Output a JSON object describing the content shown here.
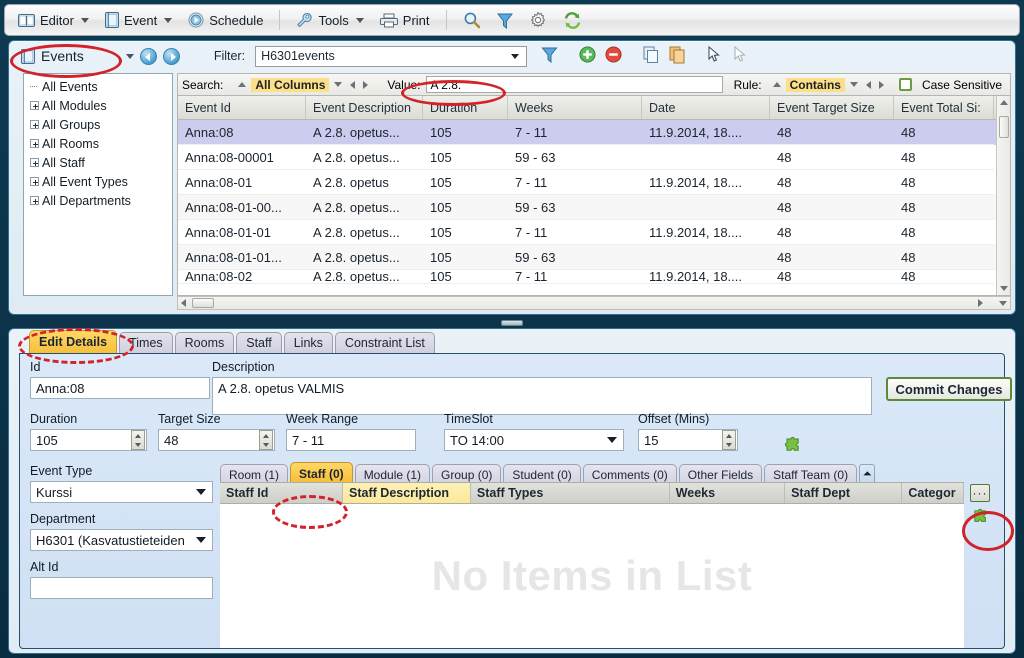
{
  "menubar": {
    "items": [
      {
        "label": "Editor",
        "icon": "book-open-icon",
        "caret": true
      },
      {
        "label": "Event",
        "icon": "book-icon",
        "caret": true
      },
      {
        "label": "Schedule",
        "icon": "play-circle-icon",
        "caret": false
      },
      {
        "label": "Tools",
        "icon": "wrench-icon",
        "caret": true
      },
      {
        "label": "Print",
        "icon": "printer-icon",
        "caret": false
      }
    ],
    "right_icons": [
      "magnifier-icon",
      "funnel-filter-icon",
      "gear-icon",
      "refresh-sync-icon"
    ]
  },
  "events_panel": {
    "title": "Events",
    "title_icon": "book-icon",
    "filter_label": "Filter:",
    "filter_value": "H6301events",
    "toolbar_icons": [
      "funnel-filter-icon",
      "add-green-icon",
      "remove-red-icon",
      "copy-icon",
      "paste-icon",
      "select-pointer-icon",
      "deselect-pointer-icon"
    ],
    "tree": [
      {
        "label": "All Events",
        "expandable": false
      },
      {
        "label": "All Modules",
        "expandable": true
      },
      {
        "label": "All Groups",
        "expandable": true
      },
      {
        "label": "All Rooms",
        "expandable": true
      },
      {
        "label": "All Staff",
        "expandable": true
      },
      {
        "label": "All Event Types",
        "expandable": true
      },
      {
        "label": "All Departments",
        "expandable": true
      }
    ],
    "search": {
      "label": "Search:",
      "scope": "All Columns",
      "value_label": "Value:",
      "value": "A 2.8.",
      "rule_label": "Rule:",
      "rule": "Contains",
      "case_sensitive_label": "Case Sensitive",
      "case_sensitive_checked": false
    },
    "grid": {
      "columns": [
        "Event Id",
        "Event Description",
        "Duration",
        "Weeks",
        "Date",
        "Event Target Size",
        "Event Total Si:"
      ],
      "rows": [
        {
          "cells": [
            "Anna:08",
            "A 2.8. opetus...",
            "105",
            "7 - 11",
            "11.9.2014, 18....",
            "48",
            "48"
          ],
          "selected": true
        },
        {
          "cells": [
            "Anna:08-00001",
            "A 2.8. opetus...",
            "105",
            "59 - 63",
            "",
            "48",
            "48"
          ],
          "selected": false
        },
        {
          "cells": [
            "Anna:08-01",
            "A 2.8. opetus",
            "105",
            "7 - 11",
            "11.9.2014, 18....",
            "48",
            "48"
          ],
          "selected": false
        },
        {
          "cells": [
            "Anna:08-01-00...",
            "A 2.8. opetus...",
            "105",
            "59 - 63",
            "",
            "48",
            "48"
          ],
          "selected": false
        },
        {
          "cells": [
            "Anna:08-01-01",
            "A 2.8. opetus...",
            "105",
            "7 - 11",
            "11.9.2014, 18....",
            "48",
            "48"
          ],
          "selected": false
        },
        {
          "cells": [
            "Anna:08-01-01...",
            "A 2.8. opetus...",
            "105",
            "59 - 63",
            "",
            "48",
            "48"
          ],
          "selected": false
        },
        {
          "cells": [
            "Anna:08-02",
            "A 2.8. opetus...",
            "105",
            "7 - 11",
            "11.9.2014, 18....",
            "48",
            "48"
          ],
          "selected": false
        }
      ]
    }
  },
  "details_panel": {
    "tabs": [
      {
        "label": "Edit Details",
        "active": true
      },
      {
        "label": "Times",
        "active": false
      },
      {
        "label": "Rooms",
        "active": false
      },
      {
        "label": "Staff",
        "active": false
      },
      {
        "label": "Links",
        "active": false
      },
      {
        "label": "Constraint List",
        "active": false
      }
    ],
    "fields": {
      "id_label": "Id",
      "id_value": "Anna:08",
      "description_label": "Description",
      "description_value": "A 2.8. opetus VALMIS",
      "commit_label": "Commit Changes",
      "duration_label": "Duration",
      "duration_value": "105",
      "target_size_label": "Target Size",
      "target_size_value": "48",
      "week_range_label": "Week Range",
      "week_range_value": "7 - 11",
      "timeslot_label": "TimeSlot",
      "timeslot_value": "TO 14:00",
      "offset_label": "Offset (Mins)",
      "offset_value": "15",
      "event_type_label": "Event Type",
      "event_type_value": "Kurssi",
      "department_label": "Department",
      "department_value": "H6301 (Kasvatustieteiden",
      "alt_id_label": "Alt Id",
      "alt_id_value": ""
    },
    "sub_tabs": [
      {
        "label": "Room (1)",
        "active": false
      },
      {
        "label": "Staff (0)",
        "active": true
      },
      {
        "label": "Module (1)",
        "active": false
      },
      {
        "label": "Group (0)",
        "active": false
      },
      {
        "label": "Student (0)",
        "active": false
      },
      {
        "label": "Comments (0)",
        "active": false
      },
      {
        "label": "Other Fields",
        "active": false
      },
      {
        "label": "Staff Team (0)",
        "active": false
      }
    ],
    "sub_tabs_overflow_icon": "chevron-down-icon",
    "staff_list": {
      "columns": [
        {
          "label": "Staff Id",
          "highlighted": false
        },
        {
          "label": "Staff Description",
          "highlighted": true
        },
        {
          "label": "Staff Types",
          "highlighted": false
        },
        {
          "label": "Weeks",
          "highlighted": false
        },
        {
          "label": "Staff Dept",
          "highlighted": false
        },
        {
          "label": "Categor",
          "highlighted": false
        }
      ],
      "empty_message": "No Items in List",
      "more_button_label": "···",
      "side_icon": "green-puzzle-icon"
    }
  },
  "colors": {
    "annotation": "#d2232a",
    "highlight": "#fbdf8a",
    "active_tab": "#ffd966",
    "selection": "#ccccee",
    "window_frame": "#0d3a52"
  }
}
